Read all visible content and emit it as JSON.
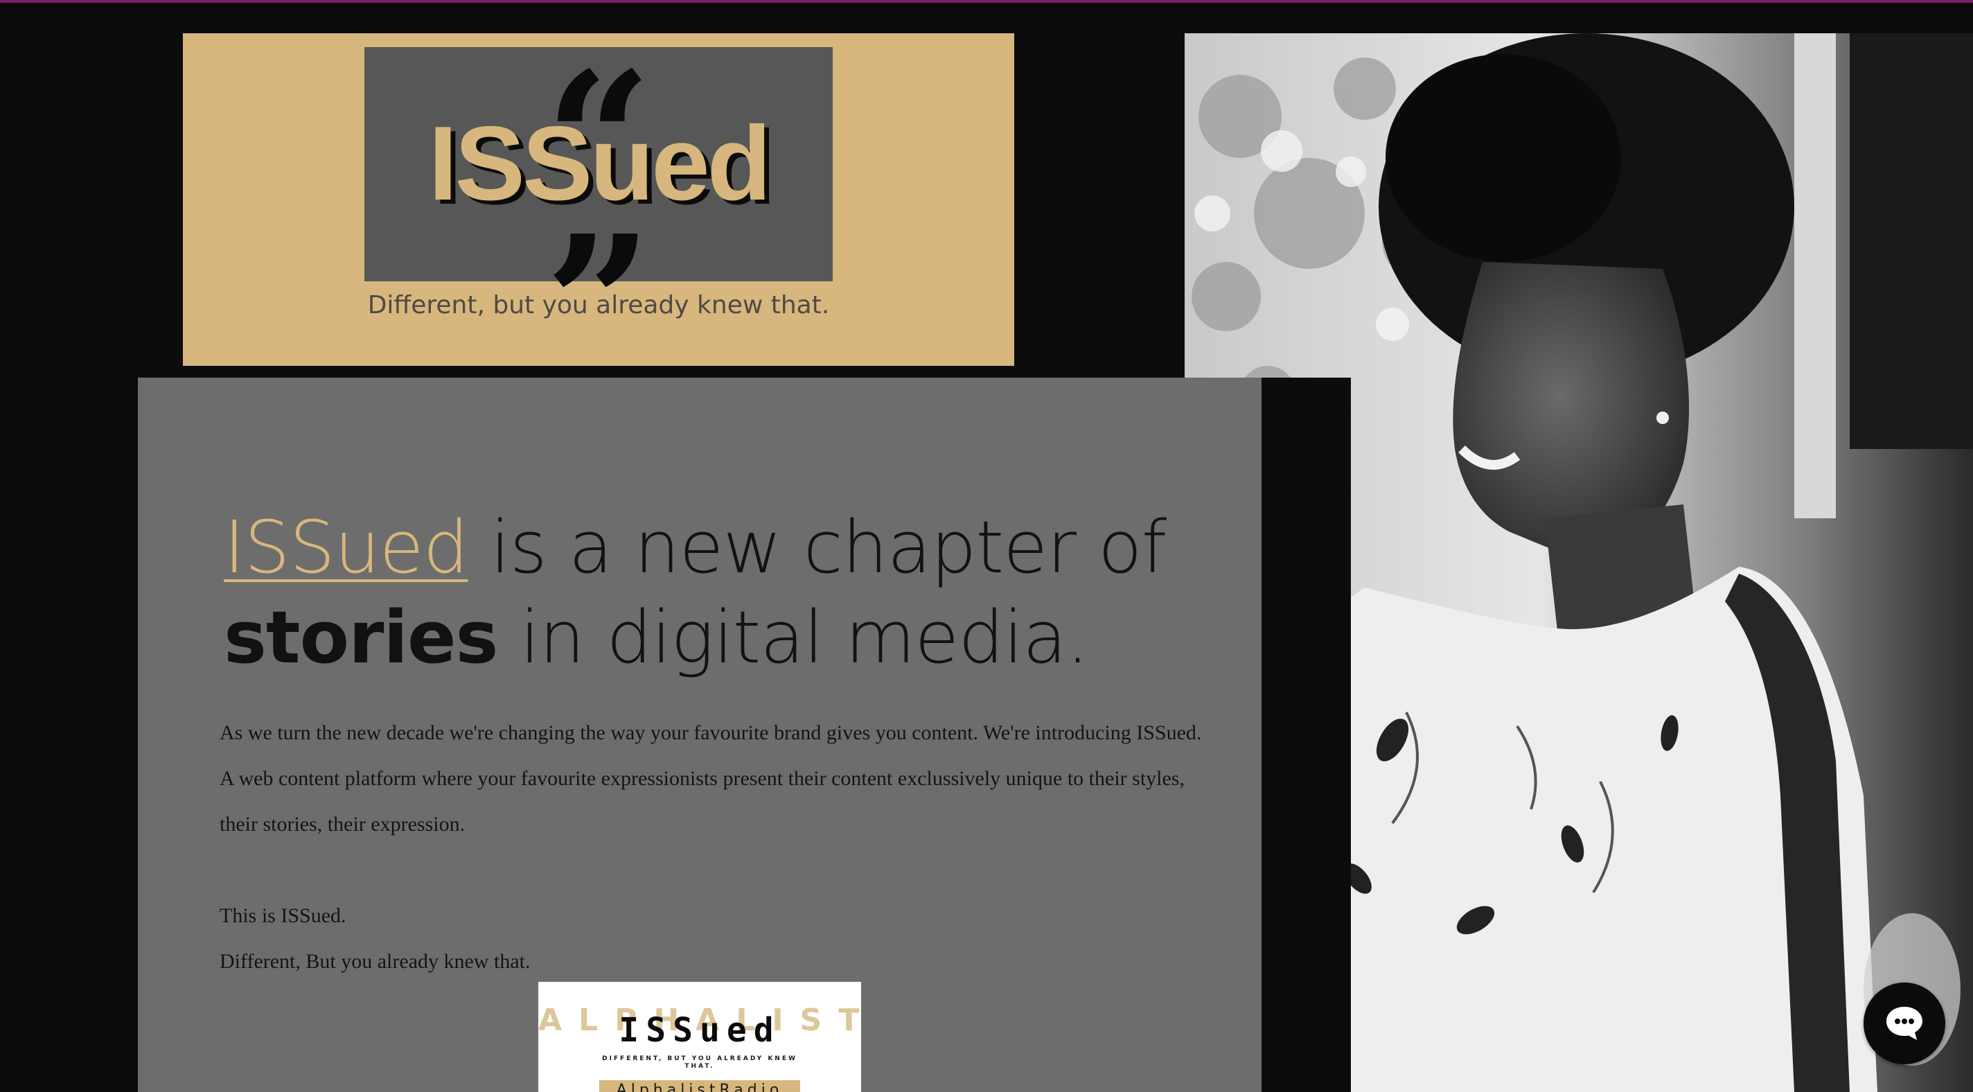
{
  "logo": {
    "open_quote": "“",
    "wordmark": "ISSued",
    "close_quote": "”",
    "tagline": "Different, but you already knew that."
  },
  "headline": {
    "brand": "ISSued",
    "line1_rest": " is a new chapter of",
    "line2_bold": "stories",
    "line2_rest": " in digital media."
  },
  "body": {
    "paragraph": "As we turn the new decade we're changing the way your favourite brand gives you content. We're introducing ISSued. A web content platform where your favourite expressionists present their content exclussively unique to their styles, their stories, their expression.",
    "line_a": "This is ISSued.",
    "line_b": "Different, But you already knew that."
  },
  "mini_card": {
    "back_text": "ALPHALIST",
    "title": "ISSued",
    "tagline": "DIFFERENT, BUT YOU ALREADY KNEW THAT.",
    "band": "AlphalistRadio"
  },
  "chat": {
    "icon": "chat-bubble-icon"
  },
  "colors": {
    "background": "#0c0c0d",
    "gold": "#d7b77d",
    "card_gray": "#6d6d6d",
    "logo_gray": "#575757",
    "top_strip": "#7a1f6e"
  }
}
